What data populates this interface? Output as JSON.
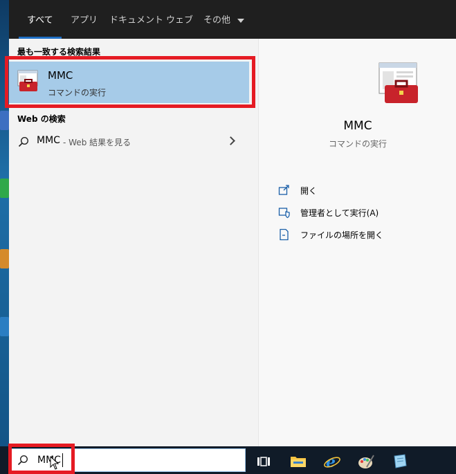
{
  "tabs": [
    {
      "label": "すべて",
      "active": true
    },
    {
      "label": "アプリ"
    },
    {
      "label": "ドキュメント"
    },
    {
      "label": "ウェブ"
    },
    {
      "label": "その他"
    }
  ],
  "best_match": {
    "heading": "最も一致する検索結果",
    "title": "MMC",
    "subtitle": "コマンドの実行"
  },
  "web_search": {
    "heading": "Web の検索",
    "query": "MMC",
    "suffix": " - Web 結果を見る"
  },
  "detail": {
    "title": "MMC",
    "subtitle": "コマンドの実行",
    "actions": [
      {
        "label": "開く",
        "icon": "open-icon"
      },
      {
        "label": "管理者として実行(A)",
        "icon": "shield-icon"
      },
      {
        "label": "ファイルの場所を開く",
        "icon": "file-location-icon"
      }
    ]
  },
  "search": {
    "value": "MMC"
  },
  "colors": {
    "accent": "#1f6fc4",
    "selection": "#a6cbe8",
    "highlight": "#e51b23"
  }
}
